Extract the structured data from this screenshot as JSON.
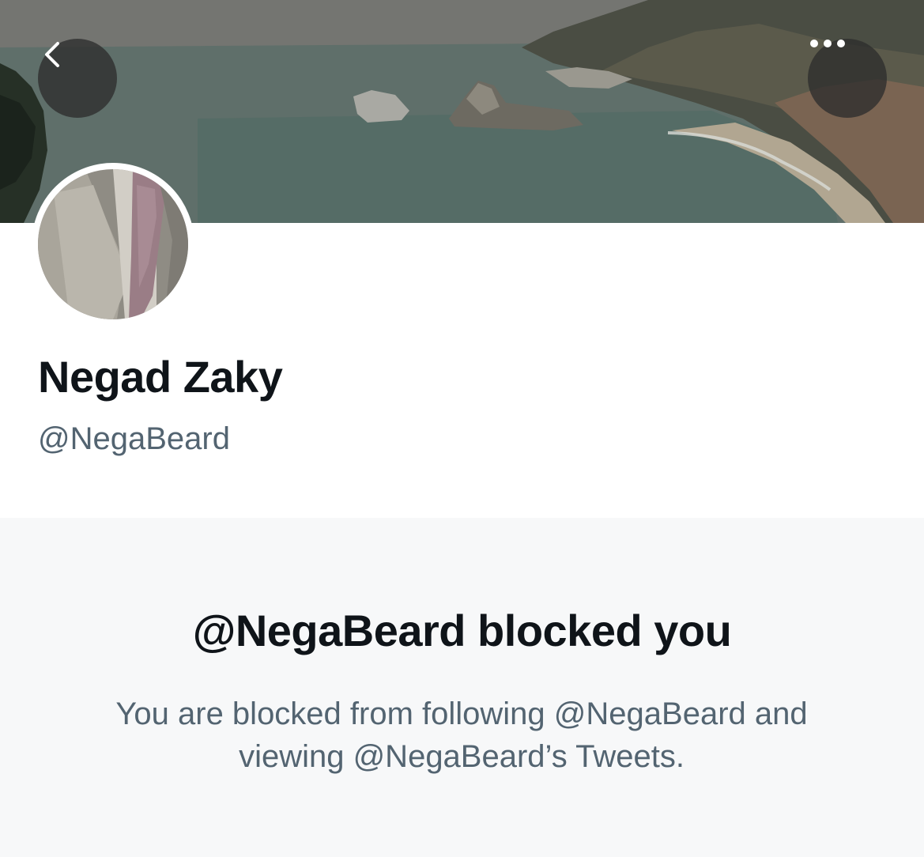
{
  "header": {
    "back_icon": "chevron-left-icon",
    "more_icon": "more-horizontal-icon"
  },
  "profile": {
    "name": "Negad Zaky",
    "handle": "@NegaBeard"
  },
  "blocked": {
    "title": "@NegaBeard blocked you",
    "description": "You are blocked from following @NegaBeard and viewing @NegaBeard’s Tweets."
  },
  "colors": {
    "text_primary": "#0f1419",
    "text_secondary": "#536471",
    "panel_background": "#f7f8f9",
    "button_overlay": "#2d2d2d"
  }
}
